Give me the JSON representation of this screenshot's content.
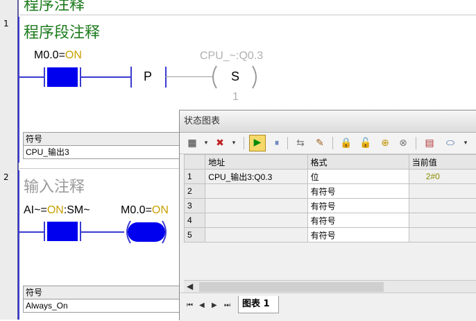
{
  "editor": {
    "top_partial_title": "程序注释",
    "networks": [
      {
        "number": "1",
        "title": "程序段注释",
        "contact_label_prefix": "M0.0=",
        "contact_label_state": "ON",
        "p_label": "P",
        "coil_address": "CPU_~:Q0.3",
        "coil_symbol": "S",
        "coil_count": "1",
        "symbol_header": "符号",
        "symbol_value": "CPU_输出3"
      },
      {
        "number": "2",
        "title": "输入注释",
        "contact_label_prefix": "AI~=",
        "contact_label_state": "ON",
        "contact_label_suffix": ":SM~",
        "coil_label_prefix": "M0.0=",
        "coil_label_state": "ON",
        "symbol_header": "符号",
        "symbol_value": "Always_On"
      }
    ]
  },
  "status_chart": {
    "title": "状态图表",
    "columns": [
      "地址",
      "格式",
      "当前值"
    ],
    "rows": [
      {
        "n": "1",
        "address": "CPU_输出3:Q0.3",
        "format": "位",
        "value": "2#0"
      },
      {
        "n": "2",
        "address": "",
        "format": "有符号",
        "value": ""
      },
      {
        "n": "3",
        "address": "",
        "format": "有符号",
        "value": ""
      },
      {
        "n": "4",
        "address": "",
        "format": "有符号",
        "value": ""
      },
      {
        "n": "5",
        "address": "",
        "format": "有符号",
        "value": ""
      }
    ],
    "sheet_tab": "图表 1",
    "toolbar_icons": [
      "add-item-icon",
      "delete-item-icon",
      "start-monitor-icon",
      "pause-icon",
      "single-read-icon",
      "write-icon",
      "lock-icon",
      "unlock-icon",
      "force-icon",
      "read-force-icon",
      "trend-icon",
      "tag-icon"
    ]
  },
  "colors": {
    "network_title": "#1b7a1b",
    "energized": "#0000ee",
    "on_state": "#c8a000",
    "current_value": "#8a8a00"
  }
}
